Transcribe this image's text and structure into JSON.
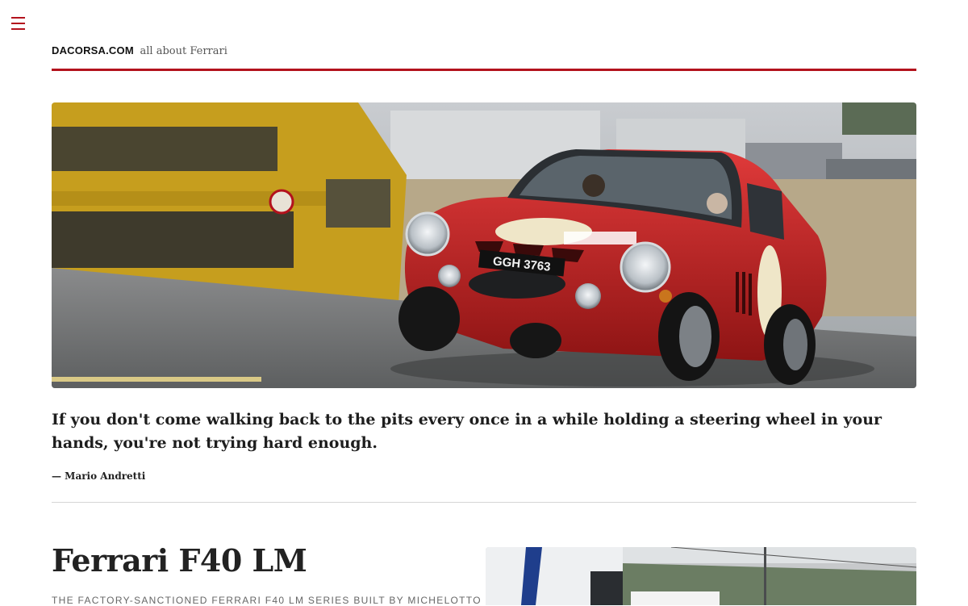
{
  "header": {
    "menu_icon": "hamburger-icon",
    "site_name": "DACORSA.COM",
    "tagline": "all about Ferrari",
    "accent_color": "#b3121d"
  },
  "hero": {
    "plate": "GGH 3763"
  },
  "quote": {
    "text": "If you don't come walking back to the pits every once in a while holding a steering wheel in your hands, you're not trying hard enough.",
    "author": "— Mario Andretti"
  },
  "article": {
    "title": "Ferrari F40 LM",
    "subtitle": "THE FACTORY-SANCTIONED FERRARI F40 LM SERIES BUILT BY MICHELOTTO"
  }
}
